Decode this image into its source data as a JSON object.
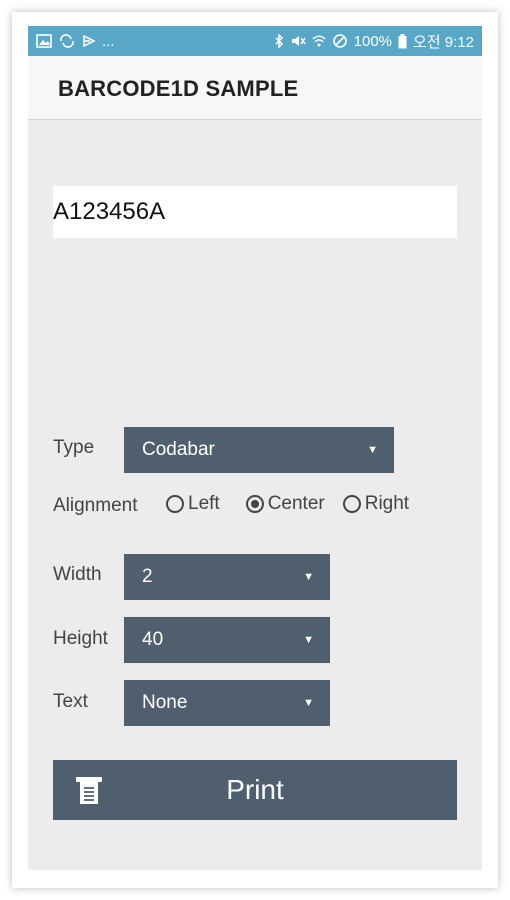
{
  "status_bar": {
    "left_icons": [
      "image-icon",
      "sync-icon",
      "cast-icon"
    ],
    "left_ellipsis": "...",
    "right_icons": [
      "bluetooth-icon",
      "mute-icon",
      "wifi-icon",
      "no-signal-icon"
    ],
    "battery_text": "100%",
    "clock_text": "오전 9:12"
  },
  "app_bar": {
    "title": "BARCODE1D SAMPLE"
  },
  "form": {
    "barcode_value": "A123456A",
    "type": {
      "label": "Type",
      "selected": "Codabar"
    },
    "alignment": {
      "label": "Alignment",
      "options": [
        {
          "label": "Left",
          "checked": false
        },
        {
          "label": "Center",
          "checked": true
        },
        {
          "label": "Right",
          "checked": false
        }
      ]
    },
    "width": {
      "label": "Width",
      "selected": "2"
    },
    "height": {
      "label": "Height",
      "selected": "40"
    },
    "text": {
      "label": "Text",
      "selected": "None"
    }
  },
  "print_button": {
    "label": "Print",
    "icon": "printer-icon"
  },
  "colors": {
    "status_bar": "#58a7c7",
    "control": "#505f6e",
    "background": "#ececec"
  }
}
